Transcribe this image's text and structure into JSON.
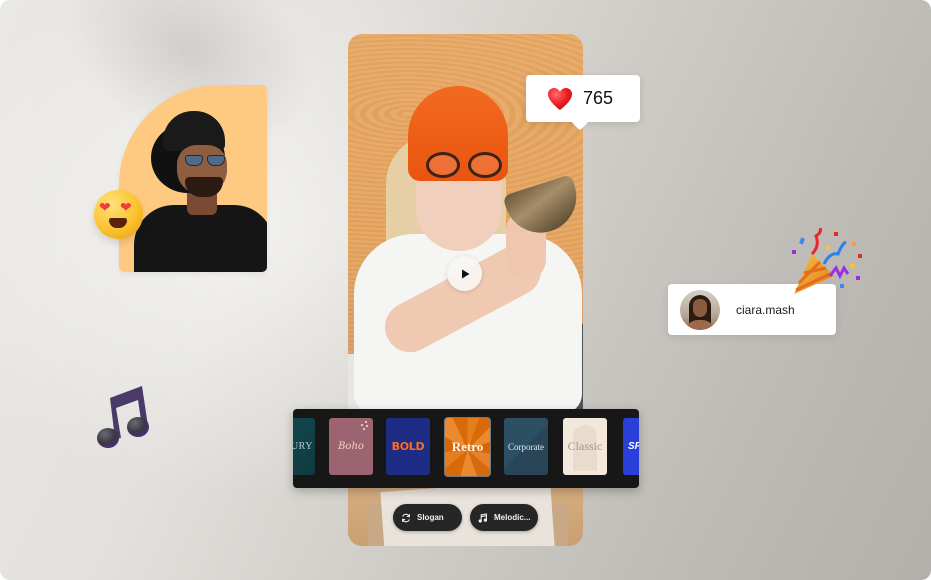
{
  "likes": {
    "icon": "heart-icon",
    "count": "765"
  },
  "user_card": {
    "username": "ciara.mash",
    "avatar": "avatar"
  },
  "video": {
    "play_icon": "play-icon"
  },
  "templates": [
    {
      "label": "LUXURY",
      "visible_text": "URY",
      "selected": false
    },
    {
      "label": "Boho",
      "selected": false
    },
    {
      "label": "BOLD",
      "selected": false
    },
    {
      "label": "Retro",
      "selected": true
    },
    {
      "label": "Corporate",
      "selected": false
    },
    {
      "label": "Classic",
      "selected": false
    },
    {
      "label": "SPORT",
      "visible_text": "SP",
      "selected": false
    }
  ],
  "chips": {
    "slogan": {
      "label": "Slogan",
      "icon": "refresh-icon"
    },
    "music": {
      "label": "Melodic...",
      "icon": "music-note-icon"
    }
  },
  "decorations": {
    "emoji_love": "heart-eyes-emoji",
    "music_note": "music-note-emoji",
    "party_popper": "party-popper-emoji"
  },
  "colors": {
    "profile_bg": "#fec980",
    "strip_bg": "#171717",
    "chip_bg": "#262626",
    "retro_orange": "#e57e1c",
    "bold_blue": "#1d2c84",
    "bold_orange": "#ff6b21",
    "boho_pink": "#9c6470",
    "corporate_teal": "#2d4f63",
    "classic_cream": "#f3e8dc",
    "sport_blue": "#2a3fd9"
  }
}
